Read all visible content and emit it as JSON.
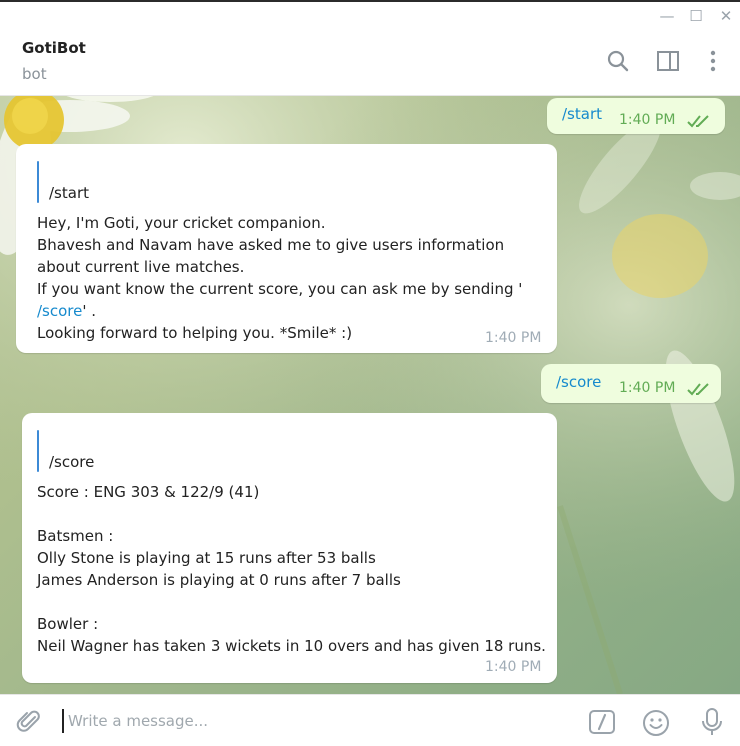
{
  "window": {
    "minimize_glyph": "—",
    "maximize_glyph": "☐",
    "close_glyph": "✕"
  },
  "header": {
    "title": "GotiBot",
    "subtitle": "bot",
    "icons": [
      "search-icon",
      "sidebar-toggle-icon",
      "more-vertical-icon"
    ]
  },
  "colors": {
    "outgoing_bubble": "#effdde",
    "incoming_bubble": "#ffffff",
    "link": "#168acd",
    "read_ticks": "#62ac55",
    "reply_bar": "#3c8ad6"
  },
  "messages": [
    {
      "direction": "outgoing",
      "text": "/start",
      "time": "1:40 PM",
      "status": "read"
    },
    {
      "direction": "incoming",
      "reply_to": "/start",
      "lines": [
        "Hey, I'm Goti, your cricket companion.",
        "Bhavesh and Navam have asked me to give users information",
        "about current live matches.",
        "If you want know the current score, you can ask me by sending '"
      ],
      "link_line_link": "/score",
      "link_line_rest": "' .",
      "last_line": "Looking forward to helping you. *Smile* :)",
      "time": "1:40 PM"
    },
    {
      "direction": "outgoing",
      "text": "/score",
      "time": "1:40 PM",
      "status": "read"
    },
    {
      "direction": "incoming",
      "reply_to": "/score",
      "lines": [
        "Score : ENG 303 & 122/9 (41)",
        "Batsmen :",
        "Olly Stone is playing at 15 runs after 53 balls",
        "James Anderson is playing at 0 runs after 7 balls",
        "Bowler :",
        "Neil Wagner has taken 3 wickets in 10 overs and has given 18 runs."
      ],
      "time": "1:40 PM"
    }
  ],
  "composer": {
    "placeholder": "Write a message...",
    "value": "",
    "icons": [
      "attach-icon",
      "bot-command-icon",
      "emoji-icon",
      "microphone-icon"
    ]
  }
}
